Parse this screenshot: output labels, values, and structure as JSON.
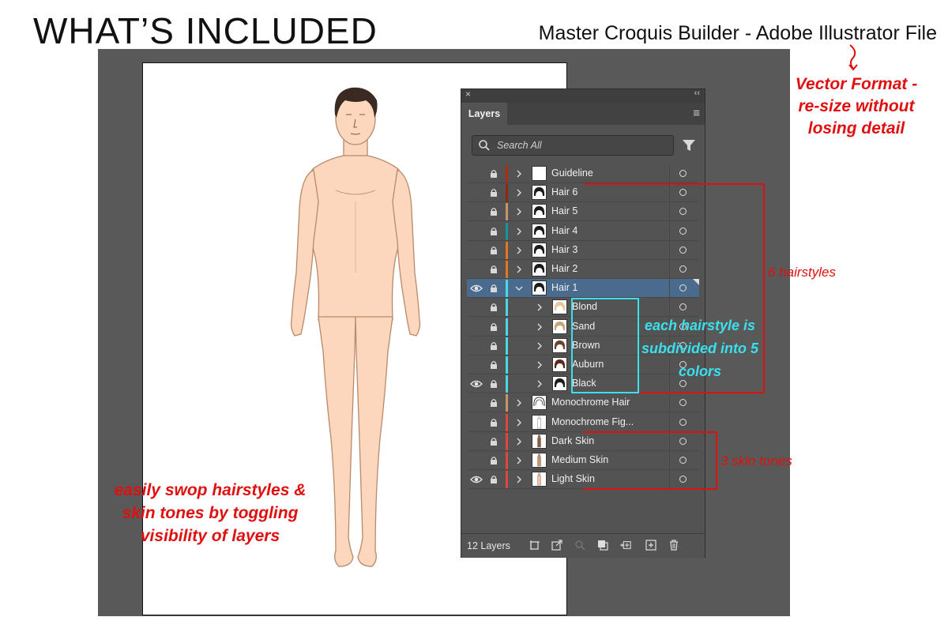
{
  "header": {
    "title": "WHAT’S INCLUDED",
    "file_title": "Master Croquis Builder - Adobe Illustrator File"
  },
  "panel": {
    "close_glyph": "×",
    "collapse_glyph": "‹‹",
    "tab_label": "Layers",
    "menu_glyph": "≡",
    "search_placeholder": "Search All",
    "layer_count": "12 Layers",
    "layers": [
      {
        "name": "Guideline",
        "color": "#b22b10",
        "visible": false,
        "expanded": false,
        "child": false,
        "selected": false,
        "thumb": "blank"
      },
      {
        "name": "Hair 6",
        "color": "#8a2a10",
        "visible": false,
        "expanded": false,
        "child": false,
        "selected": false,
        "thumb": "hair"
      },
      {
        "name": "Hair 5",
        "color": "#c8946a",
        "visible": false,
        "expanded": false,
        "child": false,
        "selected": false,
        "thumb": "hair"
      },
      {
        "name": "Hair 4",
        "color": "#17969a",
        "visible": false,
        "expanded": false,
        "child": false,
        "selected": false,
        "thumb": "hair"
      },
      {
        "name": "Hair 3",
        "color": "#e07820",
        "visible": false,
        "expanded": false,
        "child": false,
        "selected": false,
        "thumb": "hair"
      },
      {
        "name": "Hair 2",
        "color": "#e07820",
        "visible": false,
        "expanded": false,
        "child": false,
        "selected": false,
        "thumb": "hair"
      },
      {
        "name": "Hair 1",
        "color": "#48d8e8",
        "visible": true,
        "expanded": true,
        "child": false,
        "selected": true,
        "thumb": "hair"
      },
      {
        "name": "Blond",
        "color": "#48d8e8",
        "visible": false,
        "expanded": false,
        "child": true,
        "selected": false,
        "thumb": "blond"
      },
      {
        "name": "Sand",
        "color": "#48d8e8",
        "visible": false,
        "expanded": false,
        "child": true,
        "selected": false,
        "thumb": "sand"
      },
      {
        "name": "Brown",
        "color": "#48d8e8",
        "visible": false,
        "expanded": false,
        "child": true,
        "selected": false,
        "thumb": "brown"
      },
      {
        "name": "Auburn",
        "color": "#48d8e8",
        "visible": false,
        "expanded": false,
        "child": true,
        "selected": false,
        "thumb": "auburn"
      },
      {
        "name": "Black",
        "color": "#48d8e8",
        "visible": true,
        "expanded": false,
        "child": true,
        "selected": false,
        "thumb": "black"
      },
      {
        "name": "Monochrome Hair",
        "color": "#c8946a",
        "visible": false,
        "expanded": false,
        "child": false,
        "selected": false,
        "thumb": "monohair"
      },
      {
        "name": "Monochrome Fig...",
        "color": "#e04545",
        "visible": false,
        "expanded": false,
        "child": false,
        "selected": false,
        "thumb": "monofig"
      },
      {
        "name": "Dark Skin",
        "color": "#e04545",
        "visible": false,
        "expanded": false,
        "child": false,
        "selected": false,
        "thumb": "dark"
      },
      {
        "name": "Medium Skin",
        "color": "#e04545",
        "visible": false,
        "expanded": false,
        "child": false,
        "selected": false,
        "thumb": "medium"
      },
      {
        "name": "Light Skin",
        "color": "#e04545",
        "visible": true,
        "expanded": false,
        "child": false,
        "selected": false,
        "thumb": "light"
      }
    ]
  },
  "annotations": {
    "vector_format": "Vector Format - re-size without losing detail",
    "hairstyles": "6 hairstyles",
    "colors": "each hairstyle is subdivided into 5 colors",
    "skin_tones": "3 skin tones",
    "swop": "easily swop hairstyles & skin tones by toggling visibility of layers"
  },
  "colors": {
    "annotation_red": "#e01010",
    "annotation_cyan": "#3ae0ee",
    "skin": "#fcd6bd",
    "skin_outline": "#b98a6a",
    "hair": "#3a2a22"
  }
}
